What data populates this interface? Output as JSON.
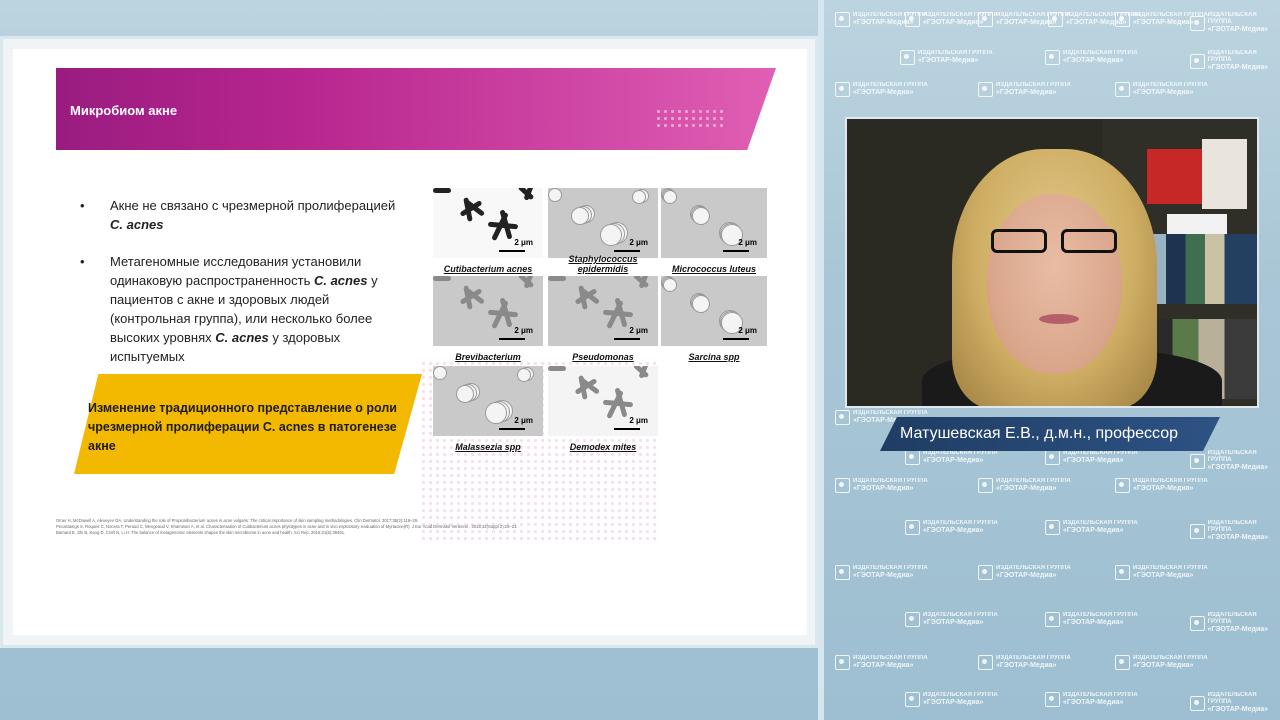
{
  "background": {
    "logo_line1": "ИЗДАТЕЛЬСКАЯ ГРУППА",
    "logo_line2": "«ГЭОТАР-Медиа»"
  },
  "slide": {
    "title": "Микробиом акне",
    "bullets": [
      {
        "text": "Акне не связано с чрезмерной пролиферацией ",
        "em": "C. acnes",
        "after": ""
      },
      {
        "text": "Метагеномные исследования установили одинаковую распространенность ",
        "em": "C. acnes",
        "after": " у пациентов с акне и здоровых людей (контрольная группа), или несколько более высоких уровнях ",
        "em2": "C. acnes",
        "after2": " у здоровых испытуемых"
      }
    ],
    "callout": "Изменение традиционного представление о роли чрезмерной пролиферации C. acnes  в патогенезе акне",
    "micrographs": [
      {
        "caption": "Cutibacterium acnes",
        "scale": "2 μm"
      },
      {
        "caption": "Staphylococcus epidermidis",
        "scale": "2 μm"
      },
      {
        "caption": "Micrococcus luteus",
        "scale": "2 μm"
      },
      {
        "caption": "Brevibacterium",
        "scale": "2 μm"
      },
      {
        "caption": "Pseudomonas",
        "scale": "2 μm"
      },
      {
        "caption": "Sarcina spp",
        "scale": "2 μm"
      },
      {
        "caption": "Malassezia spp",
        "scale": "2 μm"
      },
      {
        "caption": "Demodex mites",
        "scale": "2 μm"
      }
    ],
    "references": [
      "Omer H, McDowell A, Alexeyev OA. Understanding the role of Propionibacterium acnes in acne vulgaris: The critical importance of skin sampling methodologies. Clin Dermatol. 2017;35(2):118–29.",
      "Pecastaings S, Roques C, Nocera T, Peraud C, Mengeaud V, Khammari A, et al. Characterisation of Cutibacterium acnes phylotypes in acne and in vivo exploratory evaluation of Myrtacine(R). J Eur Acad Dermatol Venereol . 2018;32(Suppl 2):15–23.",
      "Barnard E, Shi B, Kang D, Craft N, Li H. The balance of metagenomic elements shapes the skin microbiome in acne and health. Sci Rep. 2016;21(6):39491."
    ]
  },
  "speaker": {
    "name": "Матушевская Е.В., д.м.н., профессор"
  }
}
